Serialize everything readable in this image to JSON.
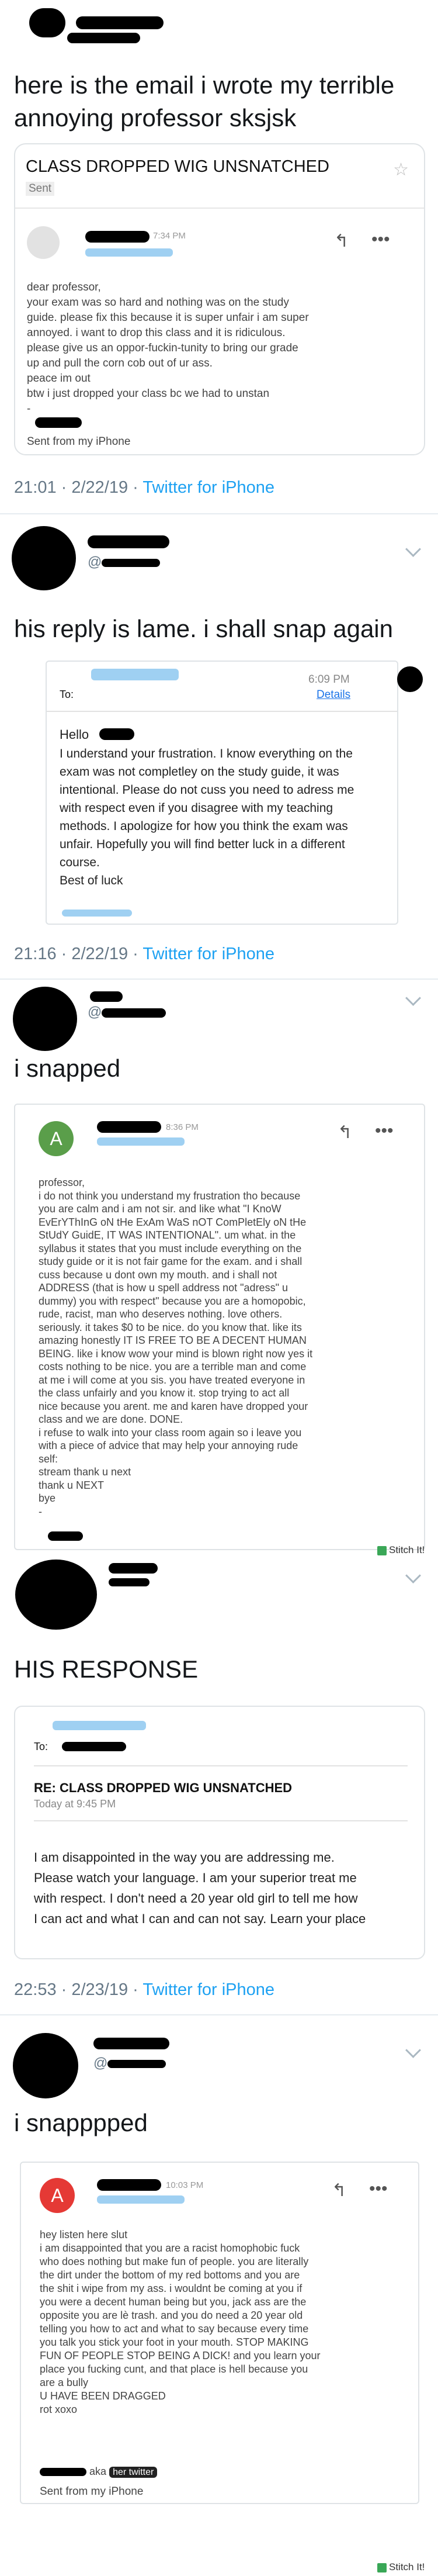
{
  "tweet1": {
    "text": "here is the email i wrote my terrible annoying professor sksjsk",
    "timestamp": "21:01 · 2/22/19 · ",
    "source": "Twitter for iPhone"
  },
  "email1": {
    "subject": "CLASS DROPPED WIG UNSNATCHED",
    "folder": "Sent",
    "time": "7:34 PM",
    "body": "dear professor,\nyour exam was so hard and nothing was on the study\nguide. please fix this because it is super unfair i am super\nannoyed. i want to drop this class and it is ridiculous.\nplease give us an oppor-fuckin-tunity to bring our grade\nup and pull the corn cob out of ur ass.\npeace im out\nbtw i just dropped your class bc we had to unstan\n-",
    "footer": "Sent from my iPhone"
  },
  "tweet2": {
    "handle_prefix": "@",
    "text": "his reply is lame. i shall snap again",
    "timestamp": "21:16 · 2/22/19 · ",
    "source": "Twitter for iPhone"
  },
  "email2": {
    "to_label": "To:",
    "time": "6:09 PM",
    "details": "Details",
    "greeting": "Hello",
    "body": "I understand your frustration. I know everything on the\nexam was not completley on the study guide, it was\nintentional. Please do not cuss you need to adress me\nwith respect even if you disagree with my teaching\nmethods. I apologize for how you think the exam was\nunfair. Hopefully you will find better luck in a different\ncourse.\nBest of luck"
  },
  "tweet3": {
    "handle_prefix": "@",
    "text": "i snapped",
    "avatar_letter": "A",
    "time": "8:36 PM",
    "body": "professor,\ni do not think you understand my frustration tho because\nyou are calm and i am not sir. and like what \"I KnoW\nEvErYThInG oN tHe ExAm WaS nOT ComPletEly oN tHe\nStUdY GuidE, IT WAS INTENTIONAL\". um what. in the\nsyllabus it states that you must include everything on the\nstudy guide or it is not fair game for the exam. and i shall\ncuss because u dont own my mouth. and i shall not\nADDRESS (that is how u spell address not \"adress\" u\ndummy) you with respect\" because you are a homopobic,\nrude, racist, man who deserves nothing. love others.\nseriously. it takes $0 to be nice. do you know that. like its\namazing honestly IT IS FREE TO BE A DECENT HUMAN\nBEING. like i know wow your mind is blown right now yes it\ncosts nothing to be nice. you are a terrible man and come\nat me i will come at you sis. you have treated everyone in\nthe class unfairly and you know it. stop trying to act all\nnice because you arent. me and karen have dropped your\nclass and we are done. DONE.\ni refuse to walk into your class room again so i leave you\nwith a piece of advice that may help your annoying rude\nself:\nstream thank u next\nthank u NEXT\nbye\n-",
    "stitch": "Stitch It!"
  },
  "tweet4": {
    "text": "HIS RESPONSE",
    "to_label": "To:",
    "subject": "RE: CLASS DROPPED WIG UNSNATCHED",
    "date": "Today at 9:45 PM",
    "body": "I am disappointed in the way you are addressing me.\nPlease watch your language. I am your superior treat me\nwith respect. I don't need a 20 year old girl to tell me how\nI can act and what I can and can not say. Learn your place",
    "timestamp": "22:53 · 2/23/19 · ",
    "source": "Twitter for iPhone"
  },
  "tweet5": {
    "handle_prefix": "@",
    "text": "i snapppped",
    "avatar_letter": "A",
    "time": "10:03 PM",
    "body": "hey listen here slut\ni am disappointed that you are a racist homophobic fuck\nwho does nothing but make fun of people. you are literally\nthe dirt under the bottom of my red bottoms and you are\nthe shit i wipe from my ass. i wouldnt be coming at you if\nyou were a decent human being but you, jack ass are the\nopposite you are lè trash. and you do need a 20 year old\ntelling you how to act and what to say because every time\nyou talk you stick your foot in your mouth. STOP MAKING\nFUN OF PEOPLE STOP BEING A DICK! and you learn your\nplace you fucking cunt, and that place is hell because you\nare a bully\nU HAVE BEEN DRAGGED\nrot xoxo",
    "aka": "aka",
    "twitter_badge": "her twitter",
    "footer": "Sent from my iPhone",
    "stitch": "Stitch It!"
  }
}
